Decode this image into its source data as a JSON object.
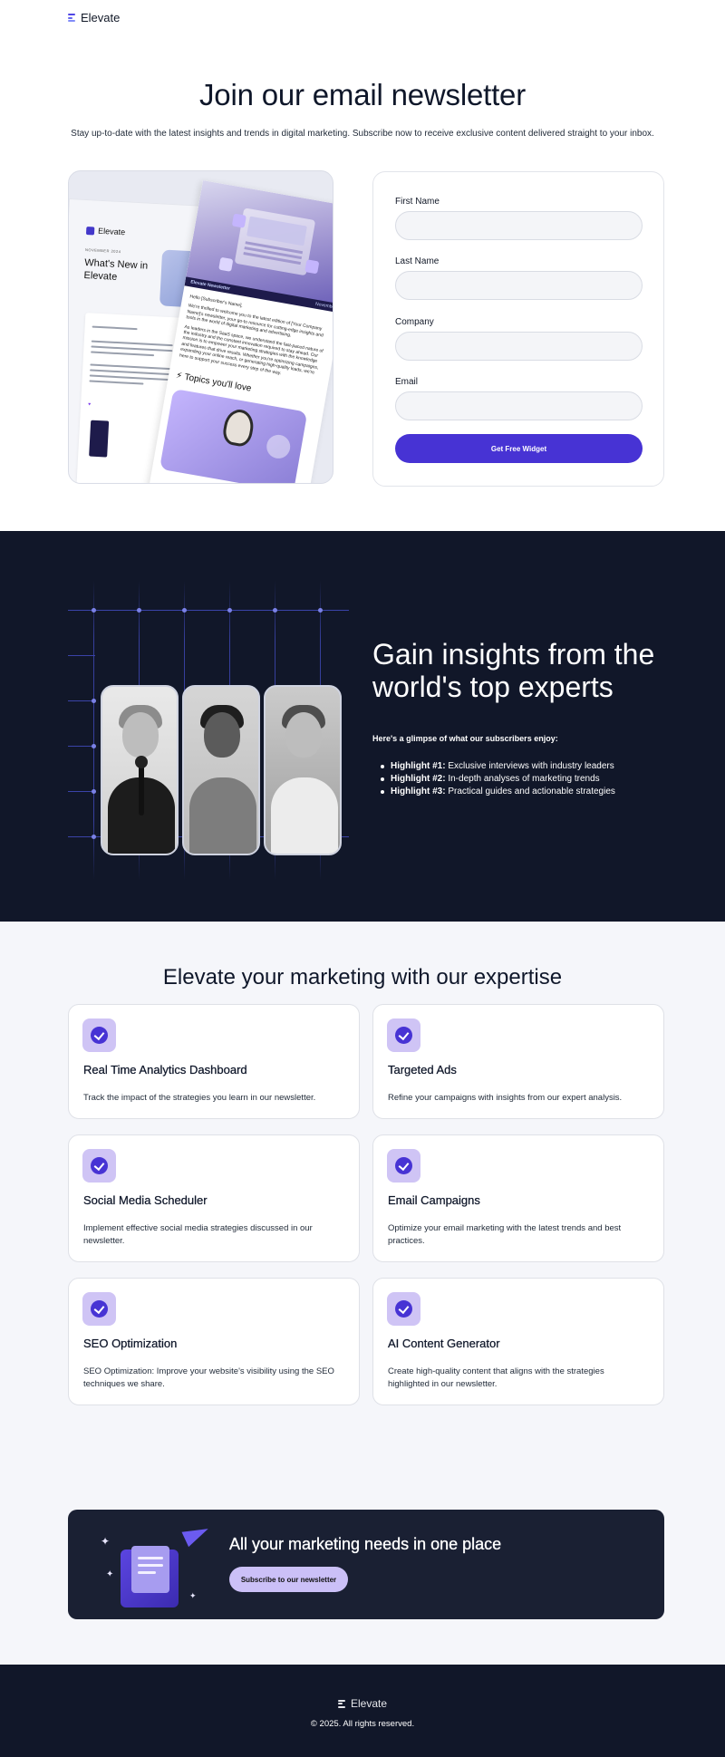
{
  "header": {
    "brand": "Elevate"
  },
  "hero": {
    "title": "Join our email newsletter",
    "subtitle": "Stay up-to-date with the latest insights and trends in digital marketing. Subscribe now to receive exclusive content delivered straight to your inbox."
  },
  "preview": {
    "brand": "Elevate",
    "date": "NOVEMBER 2024",
    "title": "What's New in Elevate",
    "band_left": "Elevate Newsletter",
    "band_right": "November",
    "greeting": "Hello [Subscriber's Name],",
    "para1": "We're thrilled to welcome you to the latest edition of [Your Company Name]'s newsletter, your go-to resource for cutting-edge insights and tools in the world of digital marketing and advertising.",
    "para2": "As leaders in the SaaS space, we understand the fast-paced nature of the industry and the constant innovation required to stay ahead. Our mission is to empower your marketing strategies with the knowledge and features that drive results. Whether you're optimizing campaigns, expanding your online reach, or generating high-quality leads, we're here to support your success every step of the way.",
    "topics": "Topics you'll love"
  },
  "form": {
    "first_name_label": "First Name",
    "last_name_label": "Last Name",
    "company_label": "Company",
    "email_label": "Email",
    "first_name_value": "",
    "last_name_value": "",
    "company_value": "",
    "email_value": "",
    "submit_label": "Get Free Widget"
  },
  "insights": {
    "title": "Gain insights from the world's top experts",
    "subtitle": "Here's a glimpse of what our subscribers enjoy:",
    "highlights": [
      {
        "label": "Highlight #1:",
        "text": "Exclusive interviews with industry leaders"
      },
      {
        "label": "Highlight #2:",
        "text": "In-depth analyses of marketing trends"
      },
      {
        "label": "Highlight #3:",
        "text": "Practical guides and actionable strategies"
      }
    ]
  },
  "features": {
    "title": "Elevate your marketing with our expertise",
    "items": [
      {
        "name": "Real Time Analytics Dashboard",
        "desc": "Track the impact of the strategies you learn in our newsletter."
      },
      {
        "name": "Targeted Ads",
        "desc": "Refine your campaigns with insights from our expert analysis."
      },
      {
        "name": "Social Media Scheduler",
        "desc": "Implement effective social media strategies discussed in our newsletter."
      },
      {
        "name": "Email Campaigns",
        "desc": "Optimize your email marketing with the latest trends and best practices."
      },
      {
        "name": "SEO Optimization",
        "desc": "SEO Optimization: Improve your website's visibility using the SEO techniques we share."
      },
      {
        "name": "AI Content Generator",
        "desc": "Create high-quality content that aligns with the strategies highlighted in our newsletter."
      }
    ]
  },
  "cta": {
    "title": "All your marketing needs in one place",
    "button_label": "Subscribe to our newsletter"
  },
  "footer": {
    "brand": "Elevate",
    "copyright": "© 2025. All rights reserved."
  },
  "colors": {
    "accent": "#4733d4",
    "accent_light": "#cfc4f5",
    "dark_bg": "#111729",
    "page_bg": "#f5f6fa"
  }
}
